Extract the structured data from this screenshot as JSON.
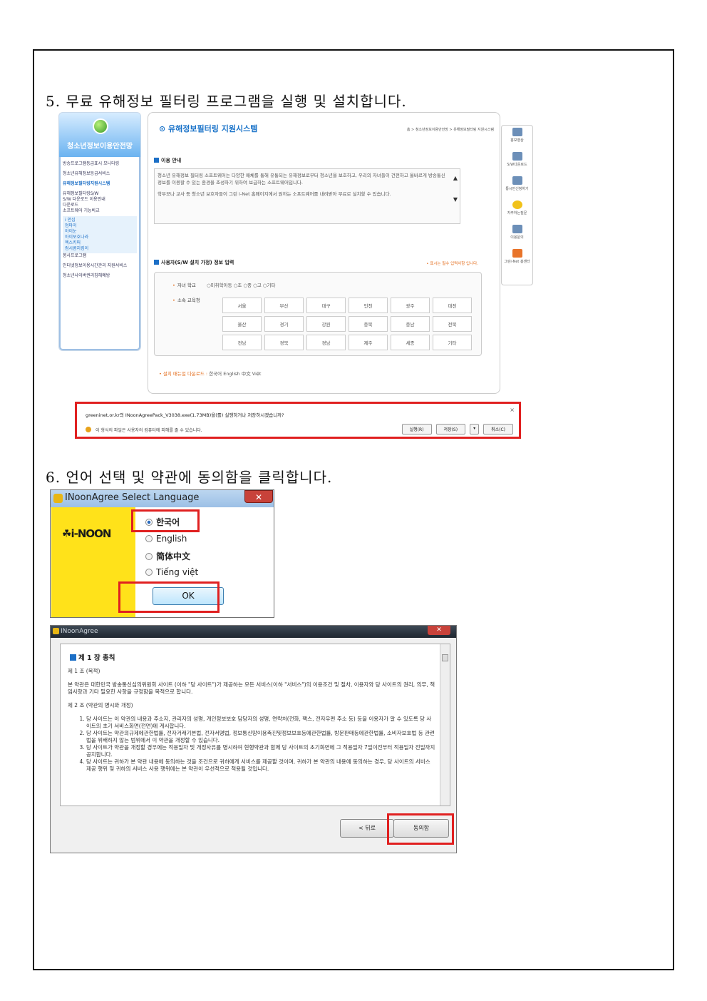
{
  "step5": {
    "title": "5. 무료 유해정보 필터링 프로그램을 실행 및 설치합니다.",
    "site": {
      "sidebar_title": "청소년정보이용안전망",
      "menu": [
        "방송프로그램등급표시 모니터링",
        "청소년유해정보등급서비스",
        "유해정보필터링지원시스템"
      ],
      "submenu": [
        "유해정보필터링S/W",
        "S/W 다운로드 이용안내",
        "다운로드",
        "소프트웨어 기능비교"
      ],
      "subitems": [
        "i 안심",
        "엄마이",
        "아이눈",
        "아이보호나라",
        "엑스키퍼",
        "컴시콤지킴이"
      ],
      "menu_tail": [
        "봉사프로그램",
        "인터넷정보이용시간관리 지원서비스",
        "청소년사이버권리침해예방"
      ],
      "page_title": "유해정보필터링 지원시스템",
      "breadcrumb": "홈 > 청소년정보이용안전망 > 유해정보필터링 지원시스템",
      "guide_label": "이용 안내",
      "guide_text_1": "청소년 유해정보 필터링 소프트웨어는 다양한 매체를 통해 유통되는 유해정보로부터 청소년을 보호하고, 우리의 자녀들이 건전하고 올바르게 방송통신 정보를 이용할 수 있는 환경을 조성하기 위하여 보급하는 소프트웨어입니다.",
      "guide_text_2": "학부모나 교사 등 청소년 보호자들이 그린 i-Net 홈페이지에서 원하는 소프트웨어를 내려받아 무료로 설치할 수 있습니다.",
      "user_label": "사용자(S/W 설치 가정) 정보 입력",
      "required_note": "• 표시는 필수 입력사항 입니다.",
      "child_school_label": "자녀 학교",
      "school_options": "○미취학아동  ○초  ○중  ○고  ○기타",
      "edu_office_label": "소속 교육청",
      "regions": [
        "서울",
        "부산",
        "대구",
        "인천",
        "광주",
        "대전",
        "울산",
        "경기",
        "강원",
        "충북",
        "충남",
        "전북",
        "전남",
        "경북",
        "경남",
        "제주",
        "세종",
        "기타"
      ],
      "manual_label": "설치 매뉴얼 다운로드 :",
      "manual_langs": "한국어  English  中文  Việt",
      "right_icons": [
        "홍보영상",
        "S/W다운로드",
        "통시민신청하기",
        "자주하는질문",
        "이용문의",
        "그린i-Net 홍센터"
      ],
      "download_message": "greeninet.or.kr의 INoonAgreePack_V3038.exe(1.73MB)을(를) 실행하거나 저장하시겠습니까?",
      "download_warning": "이 형식의 파일은 사용자의 컴퓨터에 피해를 줄 수 있습니다.",
      "btn_run": "실행(R)",
      "btn_save": "저장(S)",
      "btn_save_arrow": "▾",
      "btn_cancel": "취소(C)"
    }
  },
  "step6": {
    "title": "6. 언어 선택 및 약관에 동의함을 클릭합니다.",
    "lang_window": {
      "title": "INoonAgree Select Language",
      "logo": "i-NOON",
      "options": [
        "한국어",
        "English",
        "简体中文",
        "Tiếng việt"
      ],
      "selected": "한국어",
      "ok": "OK"
    },
    "terms_window": {
      "title": "INoonAgree",
      "chapter": "제 1 장 총칙",
      "art1_title": "제 1 조 (목적)",
      "art1_text": "본 약관은 대한민국 방송통신심의위원회 사이트 (이하 \"당 사이트\")가 제공하는 모든 서비스(이하 \"서비스\")의 이용조건 및 절차, 이용자와 당 사이트의 권리, 의무, 책임사항과 기타 필요한 사항을 규정함을 목적으로 합니다.",
      "art2_title": "제 2 조 (약관의 명시와 개정)",
      "art2_items": [
        "당 사이트는 이 약관의 내용과 주소지, 관리자의 성명, 개인정보보호 담당자의 성명, 연락처(전화, 팩스, 전자우편 주소 등) 등을 이용자가 알 수 있도록 당 사이트의 초기 서비스화면(전면)에 게시합니다.",
        "당 사이트는 약관의규제에관한법률, 전자거래기본법, 전자서명법, 정보통신망이용촉진및정보보호등에관한법률, 방문판매등에관한법률, 소비자보호법 등 관련법을 위배하지 않는 범위에서 이 약관을 개정할 수 있습니다.",
        "당 사이트가 약관을 개정할 경우에는 적용일자 및 개정사유를 명시하여 현행약관과 함께 당 사이트의 초기화면에 그 적용일자 7일이전부터 적용일자 전일까지 공지합니다.",
        "당 사이트는 귀하가 본 약관 내용에 동의하는 것을 조건으로 귀하에게 서비스를 제공할 것이며, 귀하가 본 약관의 내용에 동의하는 경우, 당 사이트의 서비스 제공 행위 및 귀하의 서비스 사용 행위에는 본 약관이 우선적으로 적용될 것입니다."
      ],
      "btn_back": "< 뒤로",
      "btn_agree": "동의함"
    }
  }
}
